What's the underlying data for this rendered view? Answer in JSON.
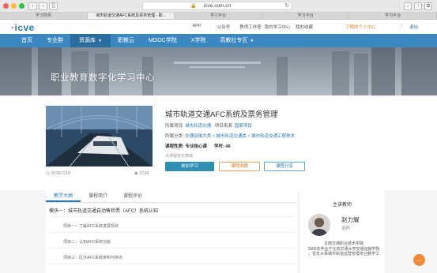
{
  "browser": {
    "address": "icve.com.cn",
    "tabs": [
      "学习导师",
      "城市轨道交通AFC系统及票务管理 - 职...",
      "学习平台",
      "学习平台",
      "学习平台"
    ]
  },
  "header": {
    "logo_text": "icve",
    "links": [
      "APP",
      "公众号",
      "教师工作室",
      "我的学习中心",
      "我的收藏"
    ],
    "user": "丁楠的个人中心",
    "separator": "|",
    "logout": "退出"
  },
  "nav": {
    "items": [
      "首页",
      "专业群",
      "资源库",
      "职教云",
      "MOOC学院",
      "X学院",
      "高教社专区"
    ]
  },
  "banner": {
    "title": "职业教育数字化学习中心"
  },
  "course": {
    "title": "城市轨道交通AFC系统及票务管理",
    "project_label": "所属项目: ",
    "project_value": "城市轨道交通",
    "source_label": "项目来源: ",
    "source_value": "国家项目",
    "category_label": "所属分类: ",
    "category_value": "交通运输大类 > 城市轨道交通类 > 城市轨道交通工程技术",
    "attr_label": "课程性质: 专业核心课",
    "hours_label": "学时: 48",
    "note": "点课程暂无推荐",
    "date": "2018/7/19",
    "views": "2749",
    "btn_join": "参加学习",
    "btn_fav": "课程收藏",
    "btn_share": "课程分享"
  },
  "content": {
    "tabs": [
      "教学大纲",
      "课程简介",
      "课程评价"
    ],
    "module": "模块一：城市轨道交通自动售检票（AFC）系统认知",
    "lessons": [
      "项目一：了解AFC系统发展现状",
      "项目二：认知AFC系统功能",
      "项目三：区分AFC系统架构与特点"
    ]
  },
  "teacher": {
    "heading": "主讲教师",
    "name": "赵力耀",
    "role": "讲师",
    "bio": [
      "云南交通职业技术学院",
      "2005年毕业于北京交通大学交通运输学院",
      "，曾年从事城市轨道运营管理专业教学工"
    ]
  },
  "colors": {
    "nav": "#3a87c2",
    "accent": "#2a7ab8",
    "orange": "#e07a1f"
  }
}
